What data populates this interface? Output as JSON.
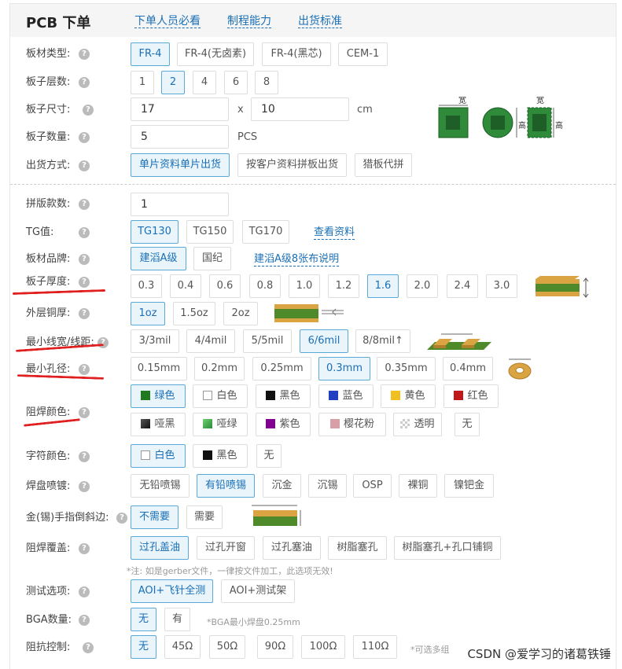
{
  "header": {
    "title": "PCB 下单",
    "links": [
      "下单人员必看",
      "制程能力",
      "出货标准"
    ]
  },
  "help_icon": "?",
  "rows": {
    "board_type": {
      "label": "板材类型:",
      "options": [
        "FR-4",
        "FR-4(无卤素)",
        "FR-4(黑芯)",
        "CEM-1"
      ],
      "selected": "FR-4"
    },
    "layers": {
      "label": "板子层数:",
      "options": [
        "1",
        "2",
        "4",
        "6",
        "8"
      ],
      "selected": "2"
    },
    "size": {
      "label": "板子尺寸:",
      "width": "17",
      "times": "x",
      "height": "10",
      "unit": "cm",
      "dim_w": "宽",
      "dim_h": "高"
    },
    "quantity": {
      "label": "板子数量:",
      "value": "5",
      "unit": "PCS"
    },
    "shipping": {
      "label": "出货方式:",
      "options": [
        "单片资料单片出货",
        "按客户资料拼板出货",
        "猎板代拼"
      ],
      "selected": "单片资料单片出货"
    },
    "panel_count": {
      "label": "拼版款数:",
      "value": "1"
    },
    "tg": {
      "label": "TG值:",
      "options": [
        "TG130",
        "TG150",
        "TG170"
      ],
      "selected": "TG130",
      "link": "查看资料"
    },
    "brand": {
      "label": "板材品牌:",
      "options": [
        "建滔A级",
        "国纪"
      ],
      "selected": "建滔A级",
      "link": "建滔A级8张布说明"
    },
    "thickness": {
      "label": "板子厚度:",
      "options": [
        "0.3",
        "0.4",
        "0.6",
        "0.8",
        "1.0",
        "1.2",
        "1.6",
        "2.0",
        "2.4",
        "3.0"
      ],
      "selected": "1.6"
    },
    "copper": {
      "label": "外层铜厚:",
      "options": [
        "1oz",
        "1.5oz",
        "2oz"
      ],
      "selected": "1oz"
    },
    "trace": {
      "label": "最小线宽/线距:",
      "options": [
        "3/3mil",
        "4/4mil",
        "5/5mil",
        "6/6mil",
        "8/8mil↑"
      ],
      "selected": "6/6mil"
    },
    "hole": {
      "label": "最小孔径:",
      "options": [
        "0.15mm",
        "0.2mm",
        "0.25mm",
        "0.3mm",
        "0.35mm",
        "0.4mm"
      ],
      "selected": "0.3mm"
    },
    "mask_color": {
      "label": "阻焊颜色:",
      "options": [
        {
          "name": "绿色",
          "swatch": "#1f7a1f"
        },
        {
          "name": "白色",
          "swatch": "#ffffff"
        },
        {
          "name": "黑色",
          "swatch": "#111111"
        },
        {
          "name": "蓝色",
          "swatch": "#2040c0"
        },
        {
          "name": "黄色",
          "swatch": "#f0c020"
        },
        {
          "name": "红色",
          "swatch": "#c01818"
        },
        {
          "name": "哑黑",
          "swatch": "#333333"
        },
        {
          "name": "哑绿",
          "swatch": "#3aa050"
        },
        {
          "name": "紫色",
          "swatch": "#800090"
        },
        {
          "name": "樱花粉",
          "swatch": "#d7a0a8"
        },
        {
          "name": "透明",
          "swatch": "#d8d8d8"
        },
        {
          "name": "无",
          "swatch": ""
        }
      ],
      "selected": "绿色"
    },
    "silk_color": {
      "label": "字符颜色:",
      "options": [
        {
          "name": "白色",
          "swatch": "#ffffff"
        },
        {
          "name": "黑色",
          "swatch": "#111111"
        },
        {
          "name": "无",
          "swatch": ""
        }
      ],
      "selected": "白色"
    },
    "finish": {
      "label": "焊盘喷镀:",
      "options": [
        "无铅喷锡",
        "有铅喷锡",
        "沉金",
        "沉锡",
        "OSP",
        "裸铜",
        "镍钯金"
      ],
      "selected": "有铅喷锡"
    },
    "bevel": {
      "label": "金(锡)手指倒斜边:",
      "options": [
        "不需要",
        "需要"
      ],
      "selected": "不需要"
    },
    "via": {
      "label": "阻焊覆盖:",
      "options": [
        "过孔盖油",
        "过孔开窗",
        "过孔塞油",
        "树脂塞孔",
        "树脂塞孔+孔口铺铜"
      ],
      "selected": "过孔盖油",
      "note": "*注: 如是gerber文件，一律按文件加工，此选项无效!"
    },
    "test": {
      "label": "测试选项:",
      "options": [
        "AOI+飞针全测",
        "AOI+测试架"
      ],
      "selected": "AOI+飞针全测"
    },
    "bga": {
      "label": "BGA数量:",
      "options": [
        "无",
        "有"
      ],
      "selected": "无",
      "note": "*BGA最小焊盘0.25mm"
    },
    "impedance": {
      "label": "阻抗控制:",
      "options": [
        "无",
        "45Ω",
        "50Ω",
        "90Ω",
        "100Ω",
        "110Ω"
      ],
      "selected": "无",
      "note": "*可选多组"
    }
  },
  "accent_colors": {
    "selected_border": "#5aa9d6",
    "selected_bg": "#e9f4fb",
    "link": "#1a6fb5",
    "annotation": "#e02020"
  },
  "watermark": "CSDN @爱学习的诸葛铁锤"
}
